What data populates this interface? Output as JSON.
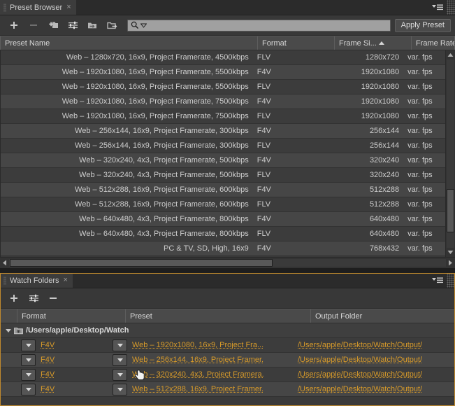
{
  "presetPanel": {
    "tab": {
      "label": "Preset Browser",
      "close": "×"
    },
    "panel_menu_icon": "panel-menu-icon",
    "toolbar": {
      "buttons": [
        {
          "name": "new-preset-button",
          "icon": "plus-icon",
          "disabled": false
        },
        {
          "name": "delete-preset-button",
          "icon": "minus-icon",
          "disabled": true
        },
        {
          "name": "new-preset-folder-button",
          "icon": "new-folder-icon",
          "disabled": false
        },
        {
          "name": "preset-settings-button",
          "icon": "settings-sliders-icon",
          "disabled": false
        },
        {
          "name": "import-preset-button",
          "icon": "import-folder-icon",
          "disabled": false
        },
        {
          "name": "export-preset-button",
          "icon": "export-folder-icon",
          "disabled": false
        }
      ],
      "search_value": "",
      "search_placeholder": "",
      "search_icon": "magnifier-icon",
      "search_dropdown_icon": "chevron-down-icon",
      "apply_label": "Apply Preset"
    },
    "columns": [
      {
        "label": "Preset Name",
        "sorted": false
      },
      {
        "label": "Format",
        "sorted": false
      },
      {
        "label": "Frame Si...",
        "sorted": true
      },
      {
        "label": "Frame Rate",
        "sorted": false
      }
    ],
    "rows": [
      {
        "name": "Web – 1280x720, 16x9, Project Framerate, 4500kbps",
        "format": "FLV",
        "size": "1280x720",
        "rate": "var. fps"
      },
      {
        "name": "Web – 1920x1080, 16x9, Project Framerate, 5500kbps",
        "format": "F4V",
        "size": "1920x1080",
        "rate": "var. fps"
      },
      {
        "name": "Web – 1920x1080, 16x9, Project Framerate, 5500kbps",
        "format": "FLV",
        "size": "1920x1080",
        "rate": "var. fps"
      },
      {
        "name": "Web – 1920x1080, 16x9, Project Framerate, 7500kbps",
        "format": "F4V",
        "size": "1920x1080",
        "rate": "var. fps"
      },
      {
        "name": "Web – 1920x1080, 16x9, Project Framerate, 7500kbps",
        "format": "FLV",
        "size": "1920x1080",
        "rate": "var. fps"
      },
      {
        "name": "Web – 256x144, 16x9, Project Framerate, 300kbps",
        "format": "F4V",
        "size": "256x144",
        "rate": "var. fps"
      },
      {
        "name": "Web – 256x144, 16x9, Project Framerate, 300kbps",
        "format": "FLV",
        "size": "256x144",
        "rate": "var. fps"
      },
      {
        "name": "Web – 320x240, 4x3, Project Framerate, 500kbps",
        "format": "F4V",
        "size": "320x240",
        "rate": "var. fps"
      },
      {
        "name": "Web – 320x240, 4x3, Project Framerate, 500kbps",
        "format": "FLV",
        "size": "320x240",
        "rate": "var. fps"
      },
      {
        "name": "Web – 512x288, 16x9, Project Framerate, 600kbps",
        "format": "F4V",
        "size": "512x288",
        "rate": "var. fps"
      },
      {
        "name": "Web – 512x288, 16x9, Project Framerate, 600kbps",
        "format": "FLV",
        "size": "512x288",
        "rate": "var. fps"
      },
      {
        "name": "Web – 640x480, 4x3, Project Framerate, 800kbps",
        "format": "F4V",
        "size": "640x480",
        "rate": "var. fps"
      },
      {
        "name": "Web – 640x480, 4x3, Project Framerate, 800kbps",
        "format": "FLV",
        "size": "640x480",
        "rate": "var. fps"
      },
      {
        "name": "PC & TV, SD, High, 16x9",
        "format": "F4V",
        "size": "768x432",
        "rate": "var. fps"
      }
    ]
  },
  "watchPanel": {
    "tab": {
      "label": "Watch Folders",
      "close": "×"
    },
    "panel_menu_icon": "panel-menu-icon",
    "toolbar": {
      "buttons": [
        {
          "name": "add-watch-folder-button",
          "icon": "plus-icon",
          "disabled": false
        },
        {
          "name": "watch-folder-settings-button",
          "icon": "settings-sliders-icon",
          "disabled": false
        },
        {
          "name": "remove-watch-folder-button",
          "icon": "minus-icon",
          "disabled": false
        }
      ]
    },
    "columns": [
      {
        "label": ""
      },
      {
        "label": "Format"
      },
      {
        "label": "Preset"
      },
      {
        "label": "Output Folder"
      }
    ],
    "folder": {
      "path": "/Users/apple/Desktop/Watch",
      "icon": "watch-folder-icon",
      "expanded": true
    },
    "rows": [
      {
        "format": "F4V",
        "preset": "Web – 1920x1080, 16x9, Project Fra...",
        "output": "/Users/apple/Desktop/Watch/Output/"
      },
      {
        "format": "F4V",
        "preset": "Web – 256x144, 16x9, Project Framer.",
        "output": "/Users/apple/Desktop/Watch/Output/"
      },
      {
        "format": "F4V",
        "preset": "Web – 320x240, 4x3, Project Framera.",
        "output": "/Users/apple/Desktop/Watch/Output/"
      },
      {
        "format": "F4V",
        "preset": "Web – 512x288, 16x9, Project Framer.",
        "output": "/Users/apple/Desktop/Watch/Output/"
      }
    ]
  },
  "colors": {
    "panel_bg": "#333333",
    "row_odd": "#3c3c3c",
    "row_even": "#464646",
    "header_bg": "#4a4a4a",
    "link_orange": "#d89b2a",
    "focus_border": "#c08a2e",
    "text": "#cdcdcd"
  }
}
